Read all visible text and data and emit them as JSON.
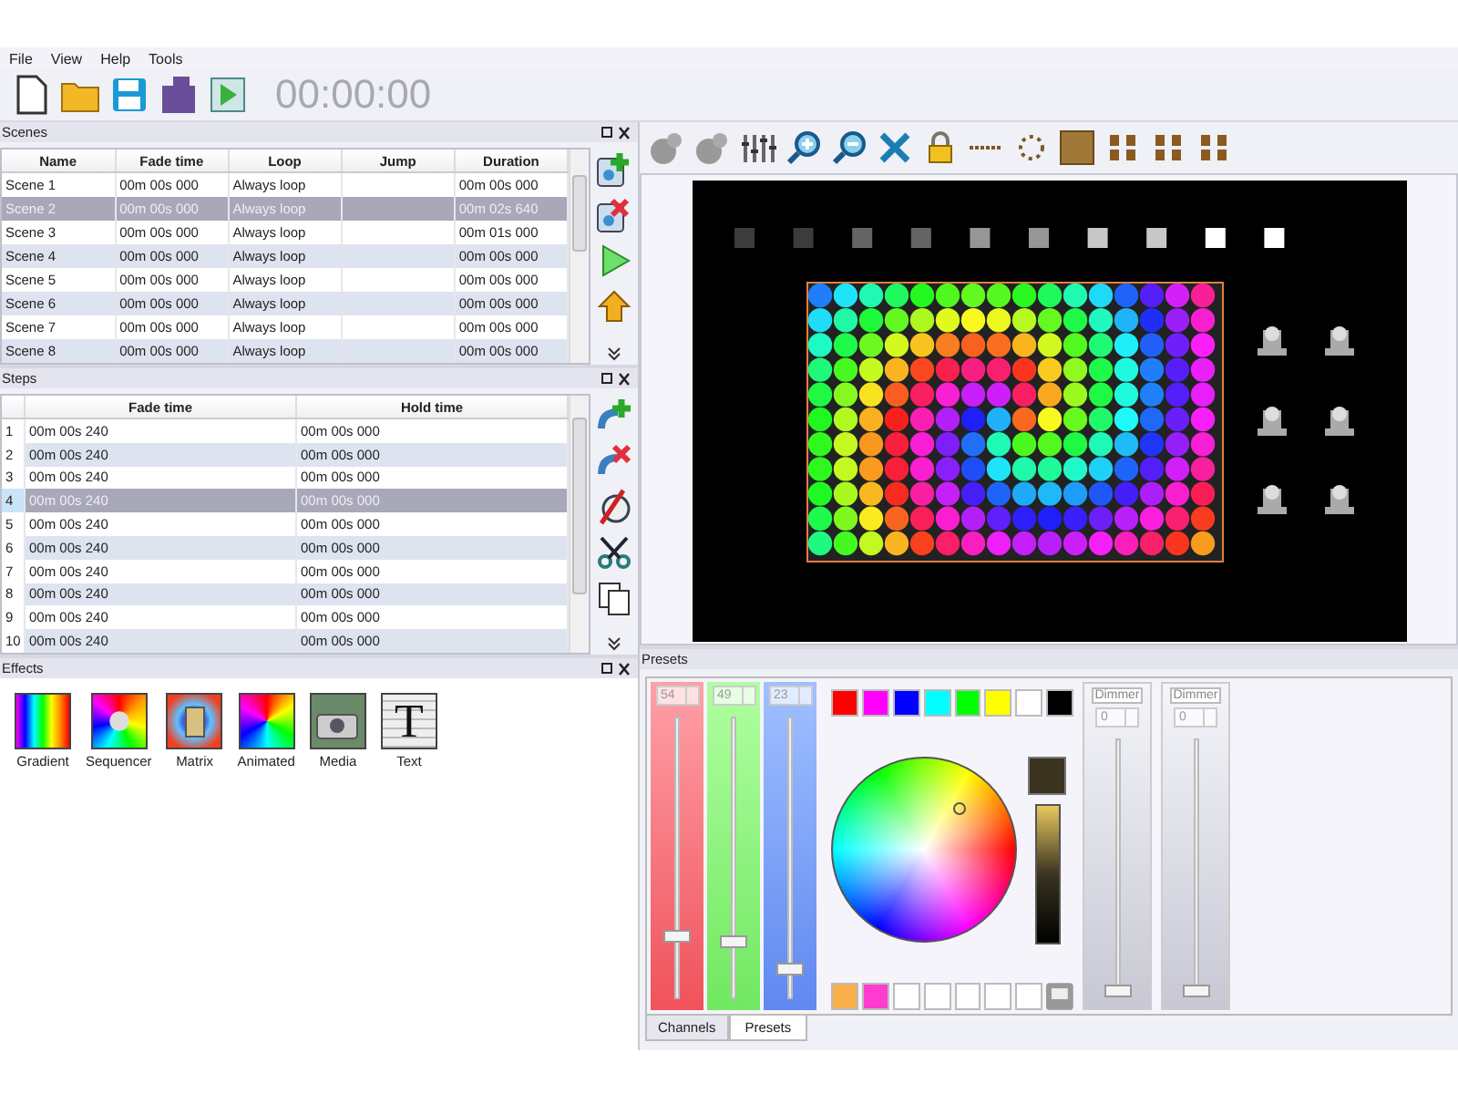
{
  "menu": [
    "File",
    "View",
    "Help",
    "Tools"
  ],
  "toolbar": {
    "timer": "00:00:00"
  },
  "scenes": {
    "title": "Scenes",
    "columns": [
      "Name",
      "Fade time",
      "Loop",
      "Jump",
      "Duration"
    ],
    "rows": [
      {
        "name": "Scene 1",
        "fade_time": "00m 00s 000",
        "loop": "Always loop",
        "duration": "00m 00s 000",
        "selected": false
      },
      {
        "name": "Scene 2",
        "fade_time": "00m 00s 000",
        "loop": "Always loop",
        "duration": "00m 02s 640",
        "selected": true
      },
      {
        "name": "Scene 3",
        "fade_time": "00m 00s 000",
        "loop": "Always loop",
        "duration": "00m 01s 000",
        "selected": false
      },
      {
        "name": "Scene 4",
        "fade_time": "00m 00s 000",
        "loop": "Always loop",
        "duration": "00m 00s 000",
        "selected": false
      },
      {
        "name": "Scene 5",
        "fade_time": "00m 00s 000",
        "loop": "Always loop",
        "duration": "00m 00s 000",
        "selected": false
      },
      {
        "name": "Scene 6",
        "fade_time": "00m 00s 000",
        "loop": "Always loop",
        "duration": "00m 00s 000",
        "selected": false
      },
      {
        "name": "Scene 7",
        "fade_time": "00m 00s 000",
        "loop": "Always loop",
        "duration": "00m 00s 000",
        "selected": false
      },
      {
        "name": "Scene 8",
        "fade_time": "00m 00s 000",
        "loop": "Always loop",
        "duration": "00m 00s 000",
        "selected": false
      }
    ]
  },
  "steps": {
    "title": "Steps",
    "columns": [
      "Fade time",
      "Hold time"
    ],
    "rows": [
      {
        "number": "1",
        "fade_time": "00m 00s 240",
        "hold_time": "00m 00s 000",
        "selected": false
      },
      {
        "number": "2",
        "fade_time": "00m 00s 240",
        "hold_time": "00m 00s 000",
        "selected": false
      },
      {
        "number": "3",
        "fade_time": "00m 00s 240",
        "hold_time": "00m 00s 000",
        "selected": false
      },
      {
        "number": "4",
        "fade_time": "00m 00s 240",
        "hold_time": "00m 00s 000",
        "selected": true
      },
      {
        "number": "5",
        "fade_time": "00m 00s 240",
        "hold_time": "00m 00s 000",
        "selected": false
      },
      {
        "number": "6",
        "fade_time": "00m 00s 240",
        "hold_time": "00m 00s 000",
        "selected": false
      },
      {
        "number": "7",
        "fade_time": "00m 00s 240",
        "hold_time": "00m 00s 000",
        "selected": false
      },
      {
        "number": "8",
        "fade_time": "00m 00s 240",
        "hold_time": "00m 00s 000",
        "selected": false
      },
      {
        "number": "9",
        "fade_time": "00m 00s 240",
        "hold_time": "00m 00s 000",
        "selected": false
      },
      {
        "number": "10",
        "fade_time": "00m 00s 240",
        "hold_time": "00m 00s 000",
        "selected": false
      }
    ]
  },
  "effects": {
    "title": "Effects",
    "items": [
      {
        "kind": "gradient",
        "label": "Gradient"
      },
      {
        "kind": "sequencer",
        "label": "Sequencer"
      },
      {
        "kind": "matrix",
        "label": "Matrix"
      },
      {
        "kind": "animated",
        "label": "Animated"
      },
      {
        "kind": "media",
        "label": "Media"
      },
      {
        "kind": "text",
        "label": "Text",
        "glyph": "T"
      }
    ]
  },
  "presets": {
    "title": "Presets",
    "rgb": [
      {
        "kind": "red",
        "value": "54",
        "level": 0.21
      },
      {
        "kind": "green",
        "value": "49",
        "level": 0.19
      },
      {
        "kind": "blue",
        "value": "23",
        "level": 0.09
      }
    ],
    "palette_top": [
      {
        "color": "#ff0000"
      },
      {
        "color": "#ff00ff"
      },
      {
        "color": "#0000ff"
      },
      {
        "color": "#00ffff"
      },
      {
        "color": "#00ff00"
      },
      {
        "color": "#ffff00"
      },
      {
        "color": "#ffffff"
      },
      {
        "color": "#000000"
      }
    ],
    "palette_bottom": [
      {
        "color": "#f7b04a"
      },
      {
        "color": "#ff3ccf"
      },
      {
        "color": "#ffffff"
      },
      {
        "color": "#ffffff"
      },
      {
        "color": "#ffffff"
      },
      {
        "color": "#ffffff"
      },
      {
        "color": "#ffffff"
      }
    ],
    "dimmers": [
      {
        "label": "Dimmer",
        "value": "0",
        "level": 0
      },
      {
        "label": "Dimmer",
        "value": "0",
        "level": 0
      }
    ],
    "tabs": [
      {
        "label": "Channels",
        "selected": false
      },
      {
        "label": "Presets",
        "selected": true
      }
    ]
  }
}
